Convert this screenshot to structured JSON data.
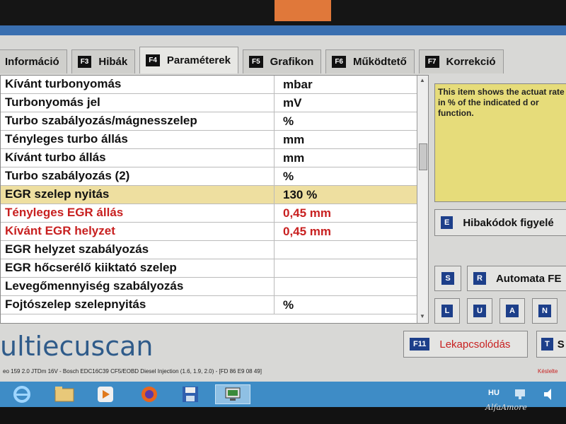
{
  "tabs": [
    {
      "key": "",
      "label": "Információ"
    },
    {
      "key": "F3",
      "label": "Hibák"
    },
    {
      "key": "F4",
      "label": "Paraméterek"
    },
    {
      "key": "F5",
      "label": "Grafikon"
    },
    {
      "key": "F6",
      "label": "Működtető"
    },
    {
      "key": "F7",
      "label": "Korrekció"
    }
  ],
  "params": [
    {
      "name": "Kívánt turbonyomás",
      "value": "mbar"
    },
    {
      "name": "Turbonyomás jel",
      "value": "mV"
    },
    {
      "name": "Turbo szabályozás/mágnesszelep",
      "value": "%"
    },
    {
      "name": "Tényleges turbo állás",
      "value": "mm"
    },
    {
      "name": "Kívánt turbo állás",
      "value": "mm"
    },
    {
      "name": "Turbo szabályozás (2)",
      "value": "%"
    },
    {
      "name": "EGR szelep nyitás",
      "value": "130 %"
    },
    {
      "name": "Tényleges EGR állás",
      "value": "0,45 mm"
    },
    {
      "name": "Kívánt EGR helyzet",
      "value": "0,45 mm"
    },
    {
      "name": "EGR helyzet szabályozás",
      "value": ""
    },
    {
      "name": "EGR hőcserélő kiiktató szelep",
      "value": ""
    },
    {
      "name": "Levegőmennyiség szabályozás",
      "value": ""
    },
    {
      "name": "Fojtószelep szelepnyitás",
      "value": "%"
    }
  ],
  "info_text": "This item shows the actuat rate in % of the indicated d or function.",
  "buttons": {
    "hibakod": {
      "key": "E",
      "label": "Hibakódok figyelé"
    },
    "s_key": "S",
    "automata": {
      "key": "R",
      "label": "Automata FE"
    },
    "lu_keys": [
      "L",
      "U",
      "A",
      "N"
    ],
    "lekapcs": {
      "key": "F11",
      "label": "Lekapcsolódás"
    },
    "t_key": "T",
    "t_label": "S"
  },
  "logo": "ultiecuscan",
  "status_text": "eo 159 2.0 JTDm 16V - Bosch EDC16C39 CF5/EOBD Diesel Injection (1.6, 1.9, 2.0) - [FD 86 E9 08 49]",
  "status_right": "Késlelte",
  "taskbar": {
    "lang": "HU"
  },
  "watermark": "AlfaAmore"
}
